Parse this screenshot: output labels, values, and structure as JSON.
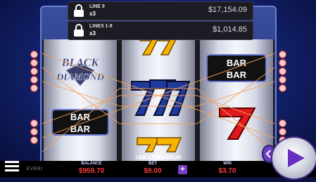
{
  "jackpots": [
    {
      "line": "LINE 9",
      "mult": "x3",
      "value": "$17,154.09"
    },
    {
      "line": "LINES 1-8",
      "mult": "x3",
      "value": "$1,014.85"
    }
  ],
  "reels": {
    "r1": {
      "logo_line1": "BLACK",
      "logo_line2": "DIAMOND",
      "bar_line1": "BAR",
      "bar_line2": "BAR"
    },
    "r3": {
      "bar_line1": "BAR",
      "bar_line2": "BAR"
    }
  },
  "status": {
    "line_pays": "LINE 4 PAYS $10.00"
  },
  "balance": {
    "label": "BALANCE",
    "value": "$959.70"
  },
  "bet": {
    "label": "BET",
    "value": "$9.00"
  },
  "win": {
    "label": "WIN",
    "value": "$3.70"
  },
  "brand": {
    "text": "EVERI"
  },
  "colors": {
    "red_seven": "#e0191c",
    "blue_seven": "#1e3a9c",
    "gold_seven": "#f4b400",
    "accent_purple": "#7a3fc7"
  }
}
